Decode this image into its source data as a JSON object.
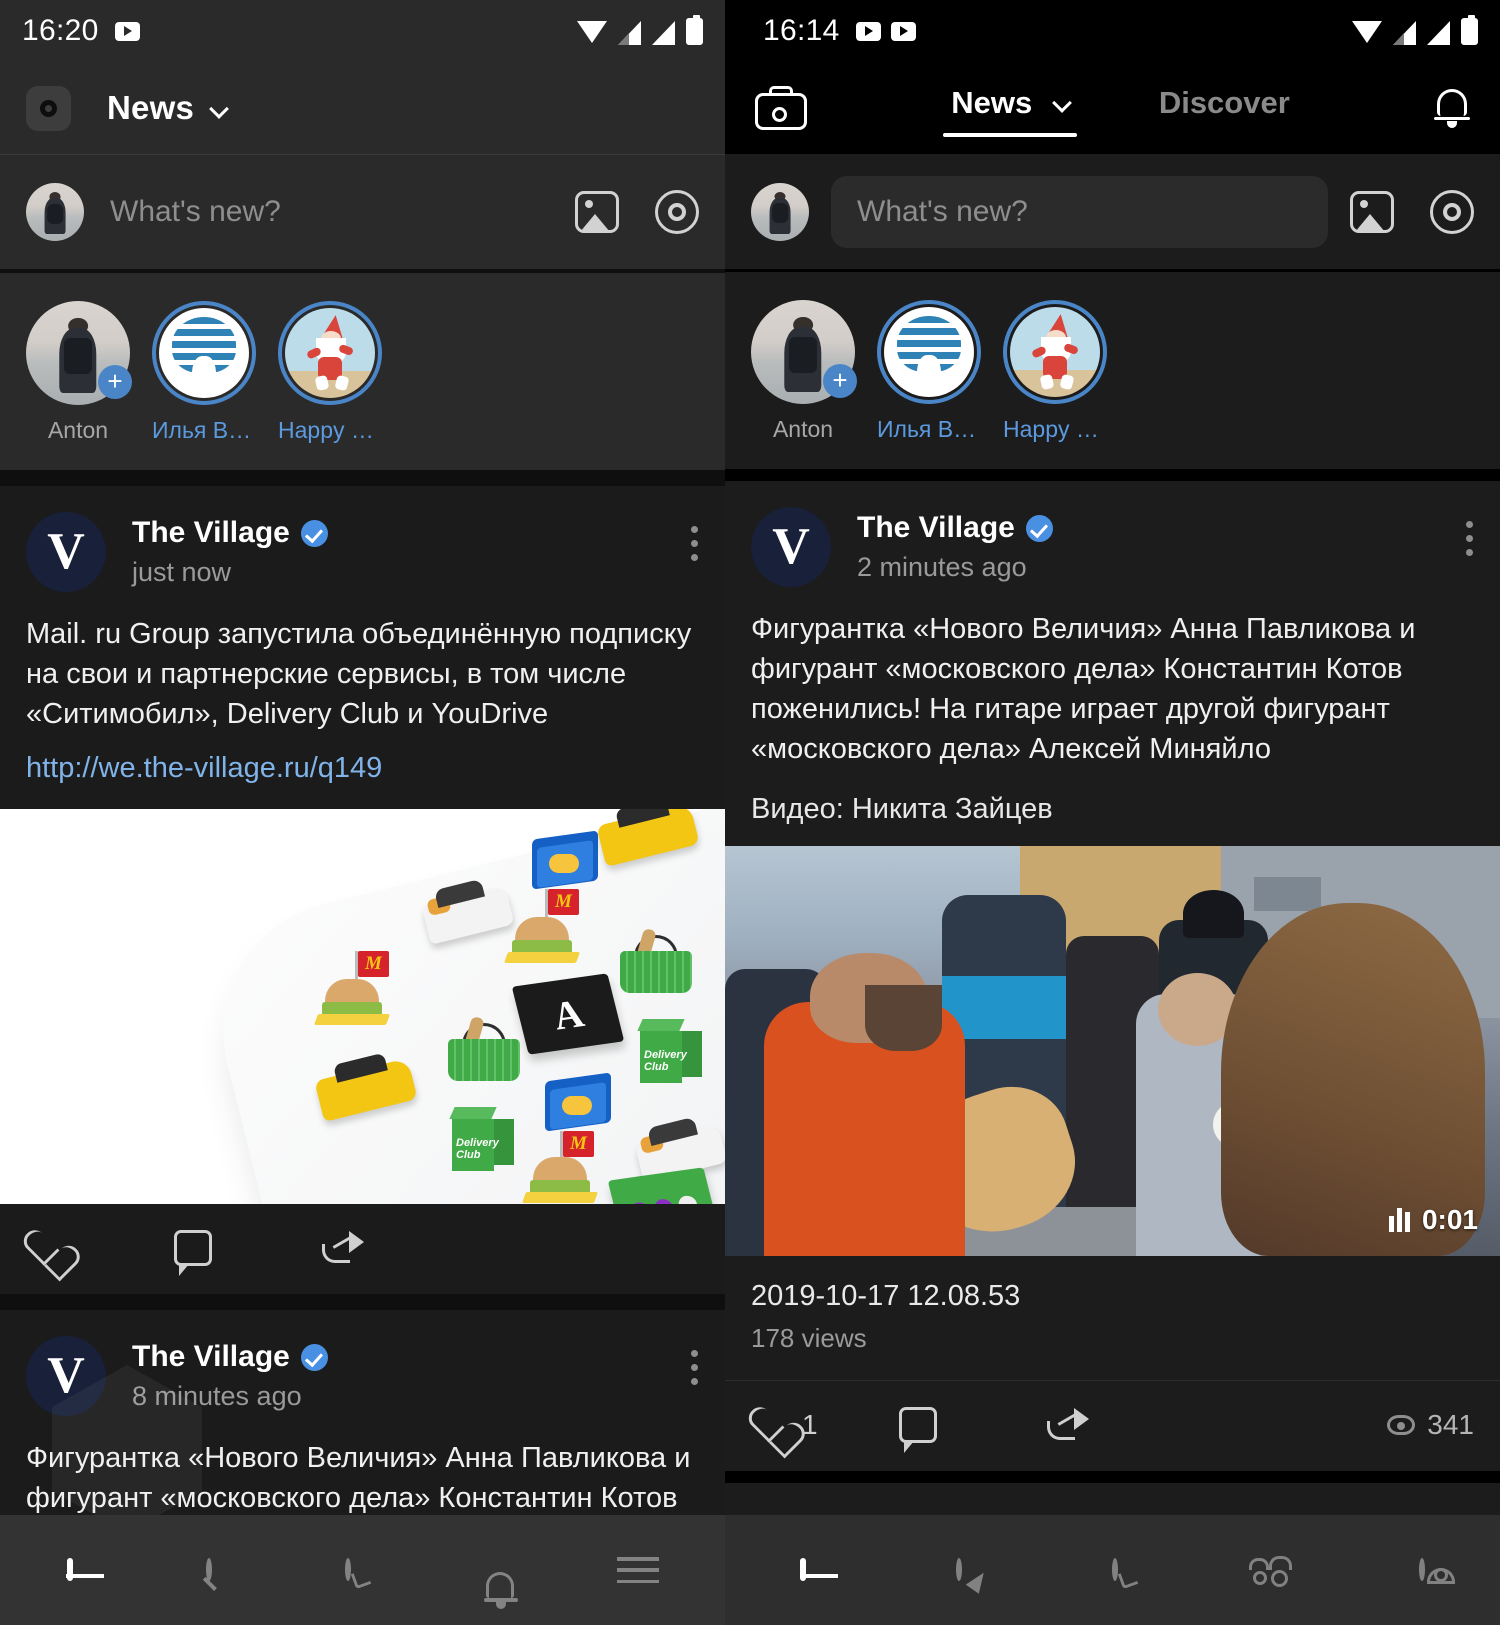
{
  "left": {
    "status": {
      "time": "16:20",
      "icons": [
        "youtube-icon",
        "wifi-icon",
        "signal-icon",
        "signal-icon",
        "battery-icon"
      ]
    },
    "appbar": {
      "camera_icon": "camera-icon",
      "title": "News",
      "chevron": "chevron-down-icon"
    },
    "composer": {
      "placeholder": "What's new?",
      "photo_icon": "photo-icon",
      "target_icon": "target-icon"
    },
    "stories": [
      {
        "label": "Anton",
        "type": "own",
        "badge": "+"
      },
      {
        "label": "Илья Варл…",
        "type": "mushroom"
      },
      {
        "label": "Happy Santa",
        "type": "santa"
      }
    ],
    "posts": [
      {
        "author": "The Village",
        "verified": true,
        "time": "just now",
        "avatar_letter": "V",
        "text": "Mail. ru Group запустила объединённую подписку на свои и партнерские сервисы, в том числе «Ситимобил», Delivery Club и YouDrive",
        "link": "http://we.the-village.ru/q149",
        "media": "mailru-promo-image",
        "actions": {
          "like_icon": "heart-icon",
          "comment_icon": "comment-icon",
          "share_icon": "share-icon"
        }
      },
      {
        "author": "The Village",
        "verified": true,
        "time": "8 minutes ago",
        "avatar_letter": "V",
        "text": "Фигурантка «Нового Величия» Анна Павликова и фигурант «московского дела» Константин Котов"
      }
    ],
    "bottom_nav": [
      "feed-icon",
      "search-icon",
      "messages-icon",
      "bell-icon",
      "menu-icon"
    ]
  },
  "right": {
    "status": {
      "time": "16:14",
      "icons": [
        "youtube-icon",
        "youtube-icon",
        "wifi-icon",
        "signal-icon",
        "signal-icon",
        "battery-icon"
      ]
    },
    "appbar": {
      "camera_icon": "camera-icon",
      "tabs": [
        {
          "label": "News",
          "active": true
        },
        {
          "label": "Discover",
          "active": false
        }
      ],
      "bell_icon": "bell-icon"
    },
    "composer": {
      "placeholder": "What's new?",
      "photo_icon": "photo-icon",
      "target_icon": "target-icon"
    },
    "stories": [
      {
        "label": "Anton",
        "type": "own",
        "badge": "+"
      },
      {
        "label": "Илья Варл…",
        "type": "mushroom"
      },
      {
        "label": "Happy Santa",
        "type": "santa"
      }
    ],
    "posts": [
      {
        "author": "The Village",
        "verified": true,
        "time": "2 minutes ago",
        "avatar_letter": "V",
        "text": "Фигурантка «Нового Величия» Анна Павликова и фигурант «московского дела» Константин Котов поженились! На гитаре играет другой фигурант «московского дела» Алексей Миняйло",
        "caption": "Видео: Никита Зайцев",
        "media": "wedding-video-thumbnail",
        "video_duration": "0:01",
        "video_title": "2019-10-17 12.08.53",
        "video_views": "178 views",
        "likes": "1",
        "views": "341",
        "actions": {
          "like_icon": "heart-icon",
          "comment_icon": "comment-icon",
          "share_icon": "share-icon",
          "views_icon": "eye-icon"
        }
      }
    ],
    "bottom_nav": [
      "feed-icon",
      "compass-icon",
      "messages-icon",
      "friends-icon",
      "profile-icon"
    ]
  },
  "colors": {
    "accent": "#4a86c7",
    "link": "#80b3e8",
    "verified": "#4a90e2",
    "bg_left": "#1b1b1b",
    "bg_right": "#1c1c1c"
  }
}
